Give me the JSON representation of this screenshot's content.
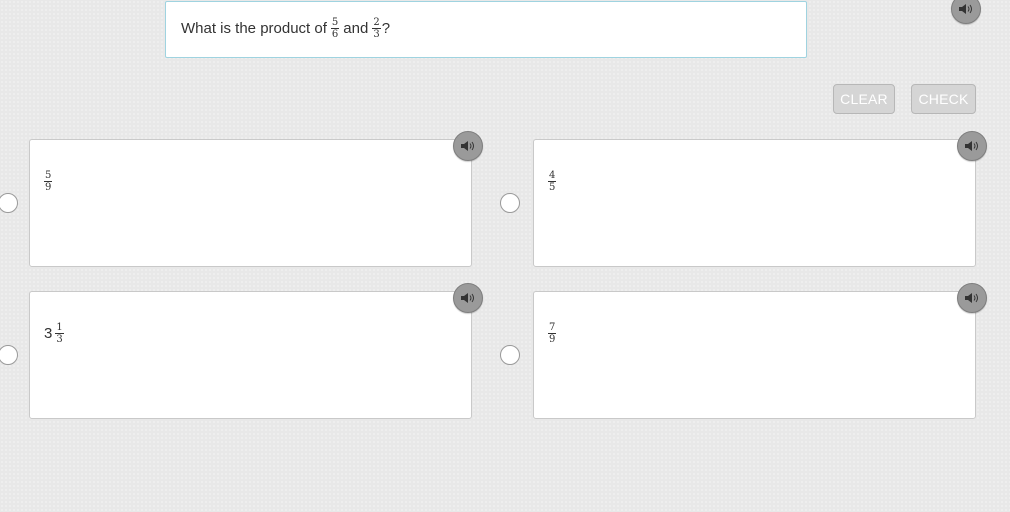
{
  "question": {
    "prefix": "What is the product of",
    "fraction1": {
      "numerator": "5",
      "denominator": "6"
    },
    "conjunction": "and",
    "fraction2": {
      "numerator": "2",
      "denominator": "3"
    },
    "suffix": "?"
  },
  "buttons": {
    "clear_label": "CLEAR",
    "check_label": "CHECK"
  },
  "options": [
    {
      "whole": "",
      "numerator": "5",
      "denominator": "9"
    },
    {
      "whole": "",
      "numerator": "4",
      "denominator": "5"
    },
    {
      "whole": "3",
      "numerator": "1",
      "denominator": "3"
    },
    {
      "whole": "",
      "numerator": "7",
      "denominator": "9"
    }
  ],
  "colors": {
    "speaker_bg": "#9a9a9a",
    "question_border": "#9fd3e0",
    "button_bg": "#d5d5d5"
  },
  "icons": {
    "audio": "speaker-icon"
  }
}
